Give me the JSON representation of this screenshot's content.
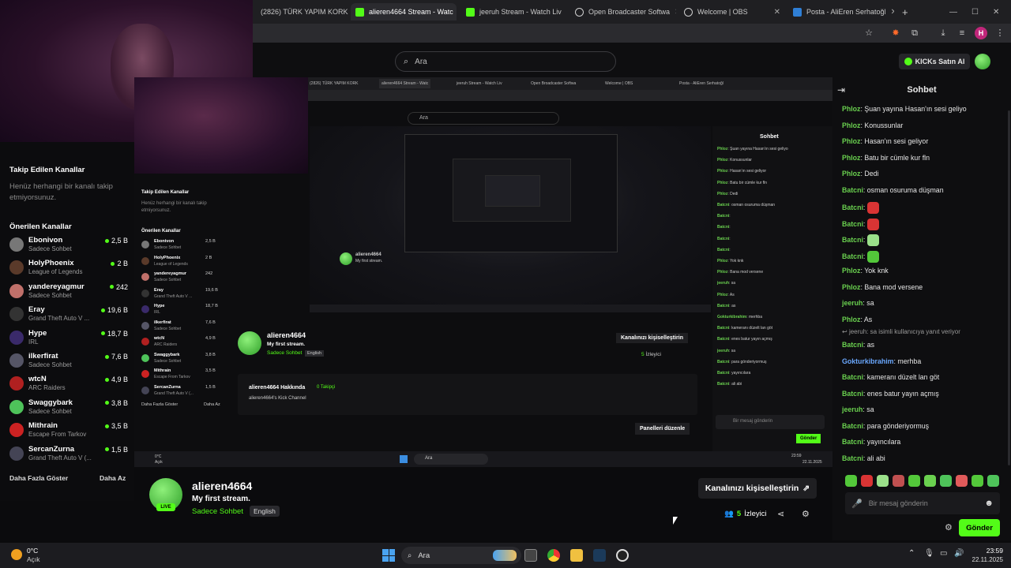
{
  "browser": {
    "tabs": [
      {
        "label": "(2826) TÜRK YAPIM KORK",
        "color": "#ff2a2a"
      },
      {
        "label": "alieren4664 Stream - Watc",
        "color": "#53fc18"
      },
      {
        "label": "jeeruh Stream - Watch Liv",
        "color": "#53fc18"
      },
      {
        "label": "Open Broadcaster Softwa",
        "color": "#cfcfcf"
      },
      {
        "label": "Welcome | OBS",
        "color": "#cfcfcf"
      },
      {
        "label": "Posta - AliEren Serhatoğl",
        "color": "#2f7fd6"
      }
    ],
    "new_tab": "+",
    "profile_initial": "H"
  },
  "header": {
    "search_placeholder": "Ara",
    "kicks_label": "KICKs Satın Al"
  },
  "sidebar": {
    "followed_title": "Takip Edilen Kanallar",
    "followed_empty": "Henüz herhangi bir kanalı takip etmiyorsunuz.",
    "recommended_title": "Önerilen Kanallar",
    "channels": [
      {
        "name": "Ebonivon",
        "category": "Sadece Sohbet",
        "viewers": "2,5 B",
        "color": "#777"
      },
      {
        "name": "HolyPhoenix",
        "category": "League of Legends",
        "viewers": "2 B",
        "color": "#5a3a2a"
      },
      {
        "name": "yandereyagmur",
        "category": "Sadece Sohbet",
        "viewers": "242",
        "color": "#c0706a"
      },
      {
        "name": "Eray",
        "category": "Grand Theft Auto V ...",
        "viewers": "19,6 B",
        "color": "#333"
      },
      {
        "name": "Hype",
        "category": "IRL",
        "viewers": "18,7 B",
        "color": "#3a2a6a"
      },
      {
        "name": "ilkerfirat",
        "category": "Sadece Sohbet",
        "viewers": "7,6 B",
        "color": "#556"
      },
      {
        "name": "wtcN",
        "category": "ARC Raiders",
        "viewers": "4,9 B",
        "color": "#b02020"
      },
      {
        "name": "Swaggybark",
        "category": "Sadece Sohbet",
        "viewers": "3,8 B",
        "color": "#4ec35a"
      },
      {
        "name": "Mithrain",
        "category": "Escape From Tarkov",
        "viewers": "3,5 B",
        "color": "#c22"
      },
      {
        "name": "SercanZurna",
        "category": "Grand Theft Auto V (...",
        "viewers": "1,5 B",
        "color": "#445"
      }
    ],
    "show_more": "Daha Fazla Göster",
    "show_less": "Daha Az"
  },
  "stream": {
    "name": "alieren4664",
    "title": "My first stream.",
    "category": "Sadece Sohbet",
    "tag": "English",
    "customize_label": "Kanalınızı kişiselleştirin",
    "viewers_count": "5",
    "viewers_label": "İzleyici",
    "about_title": "alieren4664 Hakkında",
    "followers": "0 Takipçi",
    "about_text": "alieren4664's Kick Channel",
    "edit_panels": "Panelleri düzenle"
  },
  "chat": {
    "title": "Sohbet",
    "messages": [
      {
        "user": "Phloz",
        "text": "Şuan yayına Hasan'ın sesi geliyo",
        "color": "#6ad14f"
      },
      {
        "user": "Phloz",
        "text": "Konussunlar",
        "color": "#6ad14f"
      },
      {
        "user": "Phloz",
        "text": "Hasan'ın sesi geliyor",
        "color": "#6ad14f"
      },
      {
        "user": "Phloz",
        "text": "Batu bir cümle kur fln",
        "color": "#6ad14f"
      },
      {
        "user": "Phloz",
        "text": "Dedi",
        "color": "#6ad14f"
      },
      {
        "user": "Batcni",
        "text": "osman osuruma düşman",
        "color": "#6ad14f"
      },
      {
        "user": "Batcni",
        "text": "",
        "emote": "#d93434",
        "color": "#6ad14f"
      },
      {
        "user": "Batcni",
        "text": "",
        "emote": "#d93434",
        "color": "#6ad14f"
      },
      {
        "user": "Batcni",
        "text": "",
        "emote": "#9be08a",
        "color": "#6ad14f"
      },
      {
        "user": "Batcni",
        "text": "",
        "emote": "#53c83a",
        "color": "#6ad14f"
      },
      {
        "user": "Phloz",
        "text": "Yok knk",
        "color": "#6ad14f"
      },
      {
        "user": "Phloz",
        "text": "Bana mod versene",
        "color": "#6ad14f"
      },
      {
        "user": "jeeruh",
        "text": "sa",
        "color": "#6ad14f"
      },
      {
        "user": "Phloz",
        "text": "As",
        "color": "#6ad14f"
      },
      {
        "user": "Batcni",
        "text": "as",
        "color": "#6ad14f",
        "reply": "jeeruh: sa isimli kullanıcıya yanıt veriyor"
      },
      {
        "user": "Gokturkibrahim",
        "text": "merhba",
        "color": "#6aa8ff"
      },
      {
        "user": "Batcni",
        "text": "kameranı düzelt lan göt",
        "color": "#6ad14f"
      },
      {
        "user": "Batcni",
        "text": "enes batur yayın açmış",
        "color": "#6ad14f"
      },
      {
        "user": "jeeruh",
        "text": "sa",
        "color": "#6ad14f"
      },
      {
        "user": "Batcni",
        "text": "para gönderiyormuş",
        "color": "#6ad14f"
      },
      {
        "user": "Batcni",
        "text": "yayıncılara",
        "color": "#6ad14f"
      },
      {
        "user": "Batcni",
        "text": "ali abi",
        "color": "#6ad14f"
      }
    ],
    "input_placeholder": "Bir mesaj gönderin",
    "send_label": "Gönder"
  },
  "taskbar": {
    "weather_temp": "0°C",
    "weather_desc": "Açık",
    "search_label": "Ara",
    "time": "23:59",
    "date": "22.11.2025"
  }
}
